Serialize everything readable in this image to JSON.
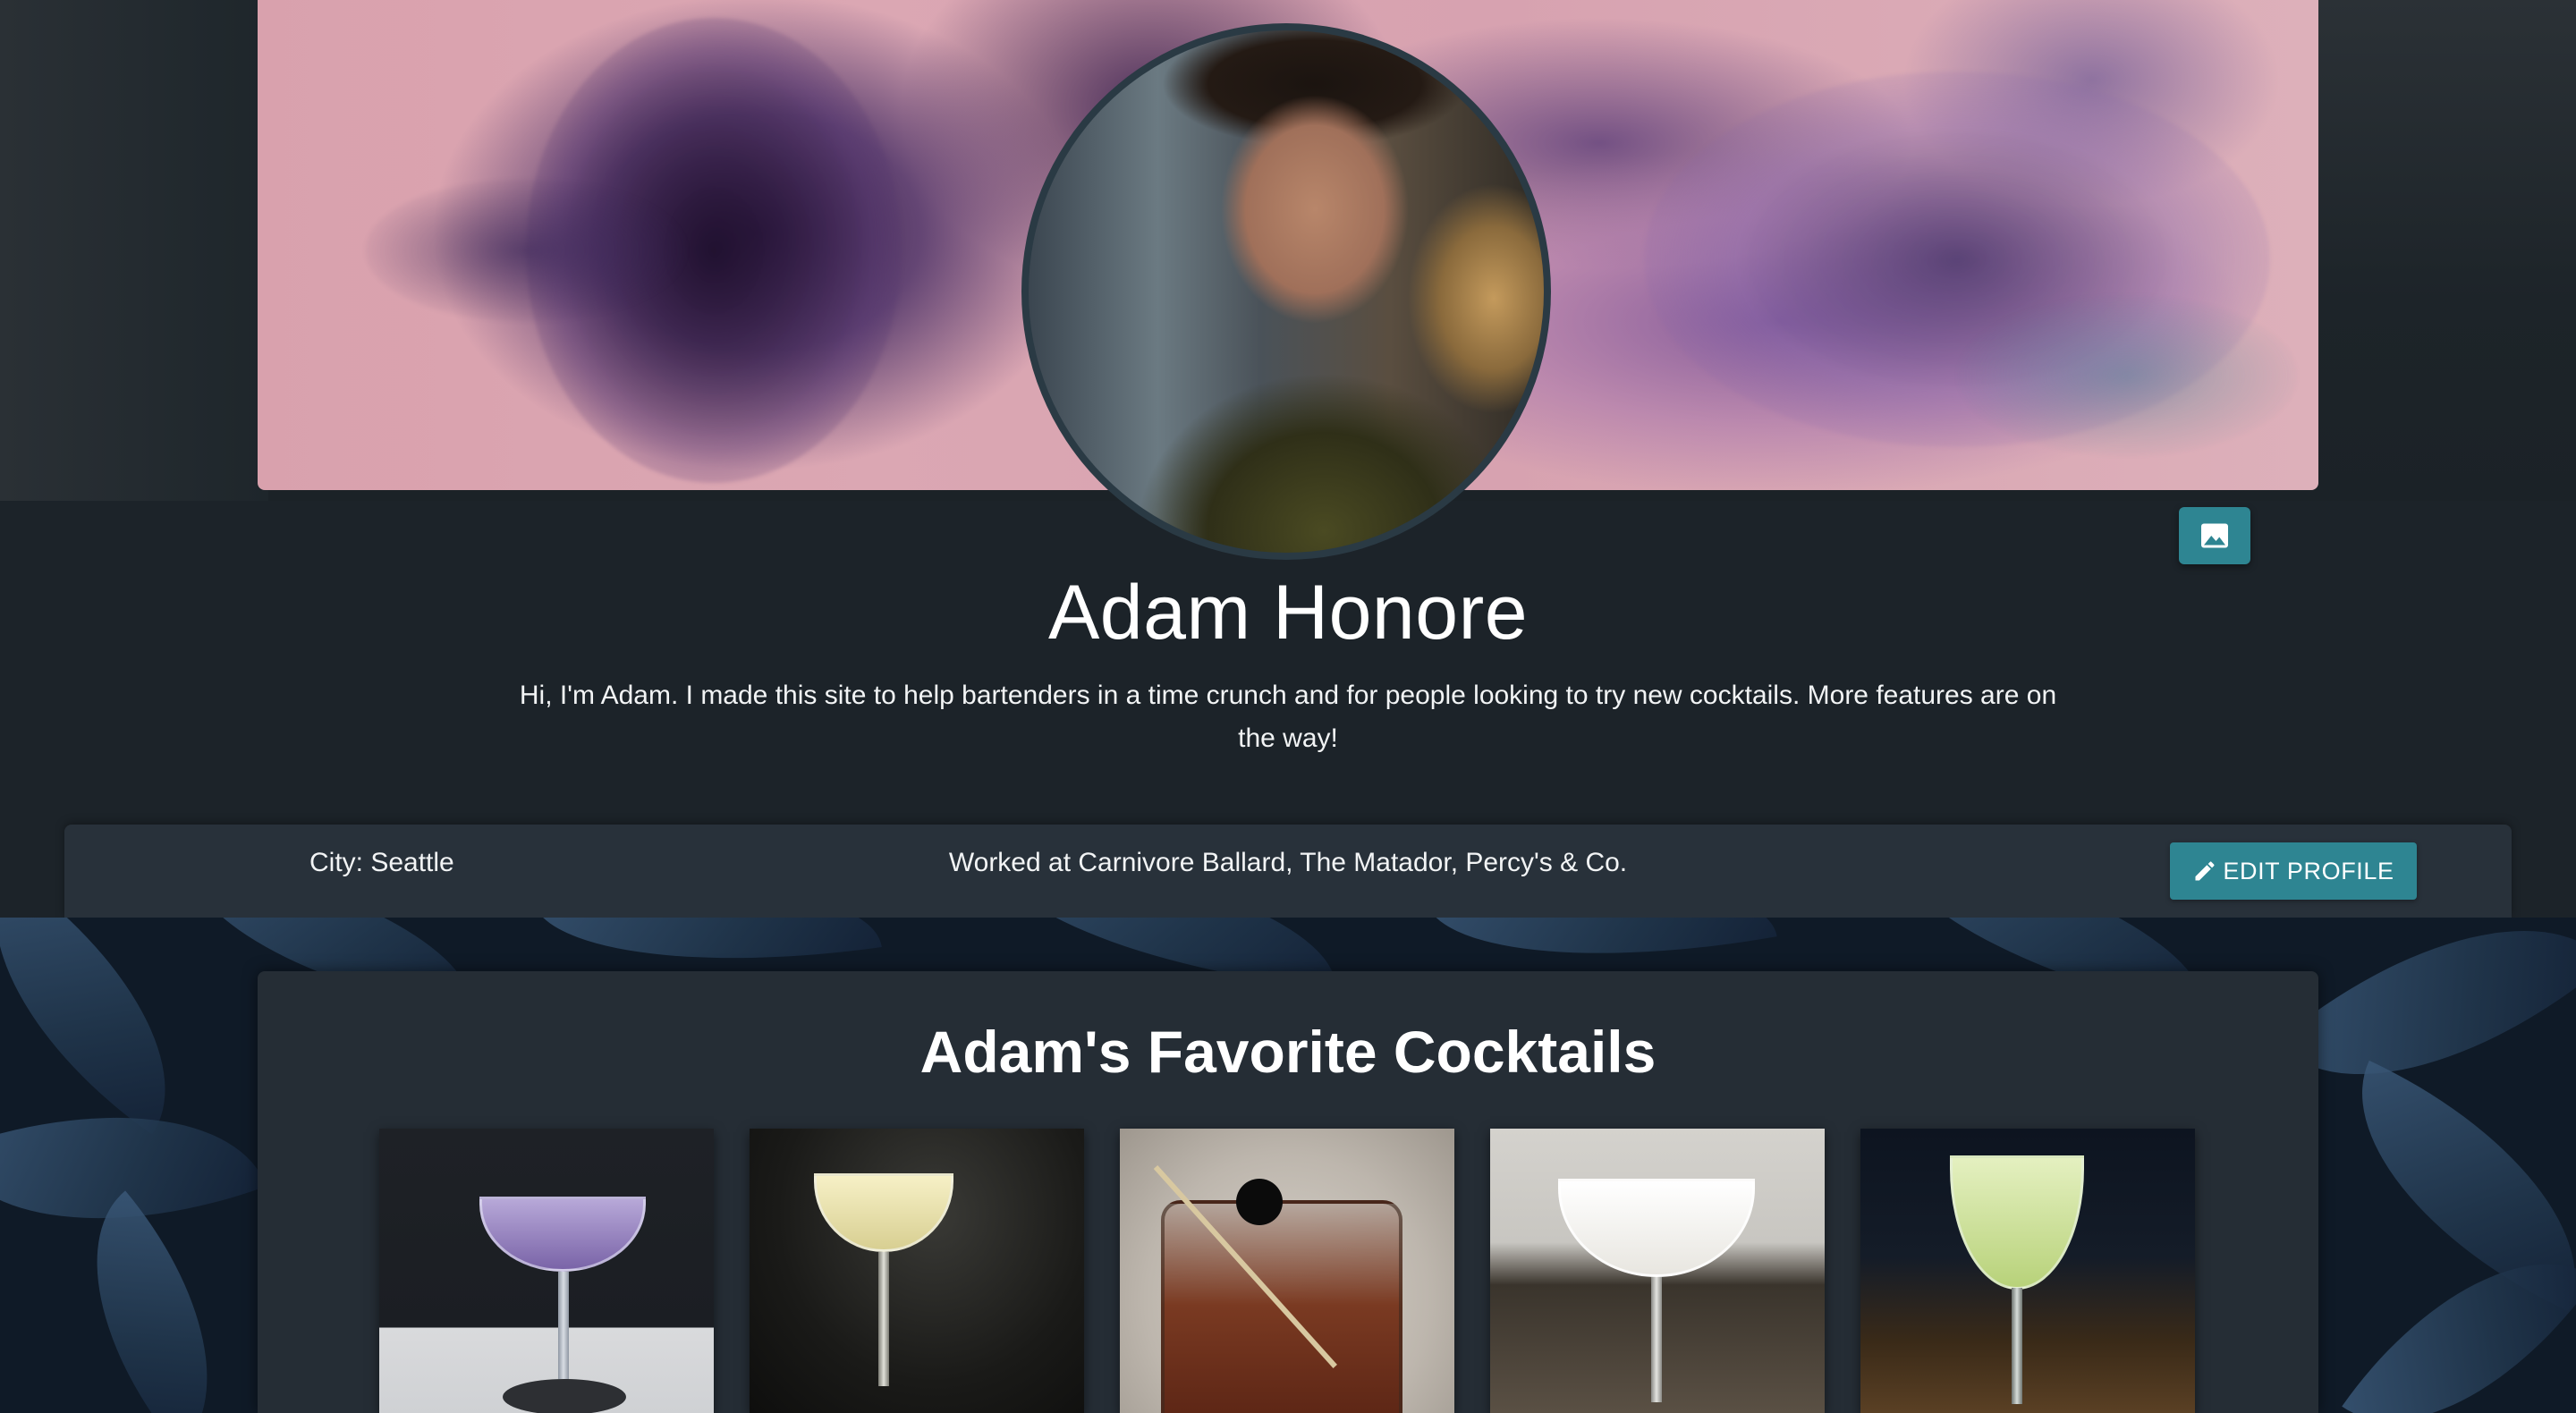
{
  "profile": {
    "name": "Adam Honore",
    "bio": "Hi, I'm Adam. I made this site to help bartenders in a time crunch and for people looking to try new cocktails. More features are on the way!",
    "city": "City: Seattle",
    "worked_at": "Worked at Carnivore Ballard, The Matador, Percy's & Co.",
    "edit_label": "EDIT PROFILE"
  },
  "favorites": {
    "title": "Adam's Favorite Cocktails"
  },
  "colors": {
    "accent": "#2e8592",
    "page_bg": "#1c2329",
    "panel_bg": "#252d35"
  },
  "icons": {
    "cover_photo": "image-icon",
    "edit": "pencil-icon"
  }
}
